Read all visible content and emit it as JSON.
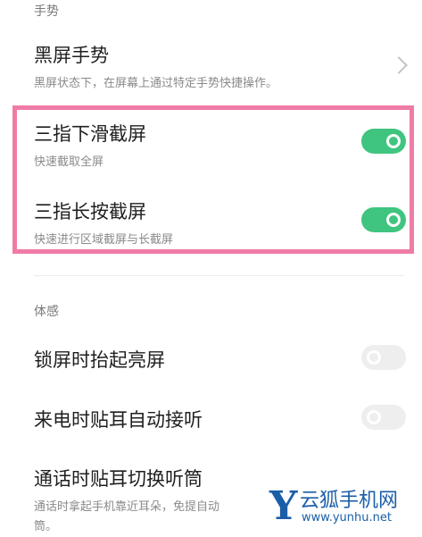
{
  "sections": {
    "gesture_header": "手势",
    "motion_header": "体感"
  },
  "items": {
    "black_screen": {
      "title": "黑屏手势",
      "subtitle": "黑屏状态下，在屏幕上通过特定手势快捷操作。"
    },
    "three_finger_swipe": {
      "title": "三指下滑截屏",
      "subtitle": "快速截取全屏",
      "enabled": true
    },
    "three_finger_press": {
      "title": "三指长按截屏",
      "subtitle": "快速进行区域截屏与长截屏",
      "enabled": true
    },
    "raise_to_wake": {
      "title": "锁屏时抬起亮屏",
      "enabled": false
    },
    "auto_answer": {
      "title": "来电时贴耳自动接听",
      "enabled": false
    },
    "switch_earpiece": {
      "title": "通话时贴耳切换听筒",
      "subtitle_line1": "通话时拿起手机靠近耳朵，免提自动",
      "subtitle_line2": "筒。"
    }
  },
  "watermark": {
    "logo_letter": "Y",
    "name": "云狐手机网",
    "url": "www.yunhu.net"
  },
  "colors": {
    "toggle_on": "#3fc57f",
    "toggle_off": "#eeeeee",
    "highlight_border": "#ef7ba6",
    "watermark": "#1b5ea8"
  }
}
